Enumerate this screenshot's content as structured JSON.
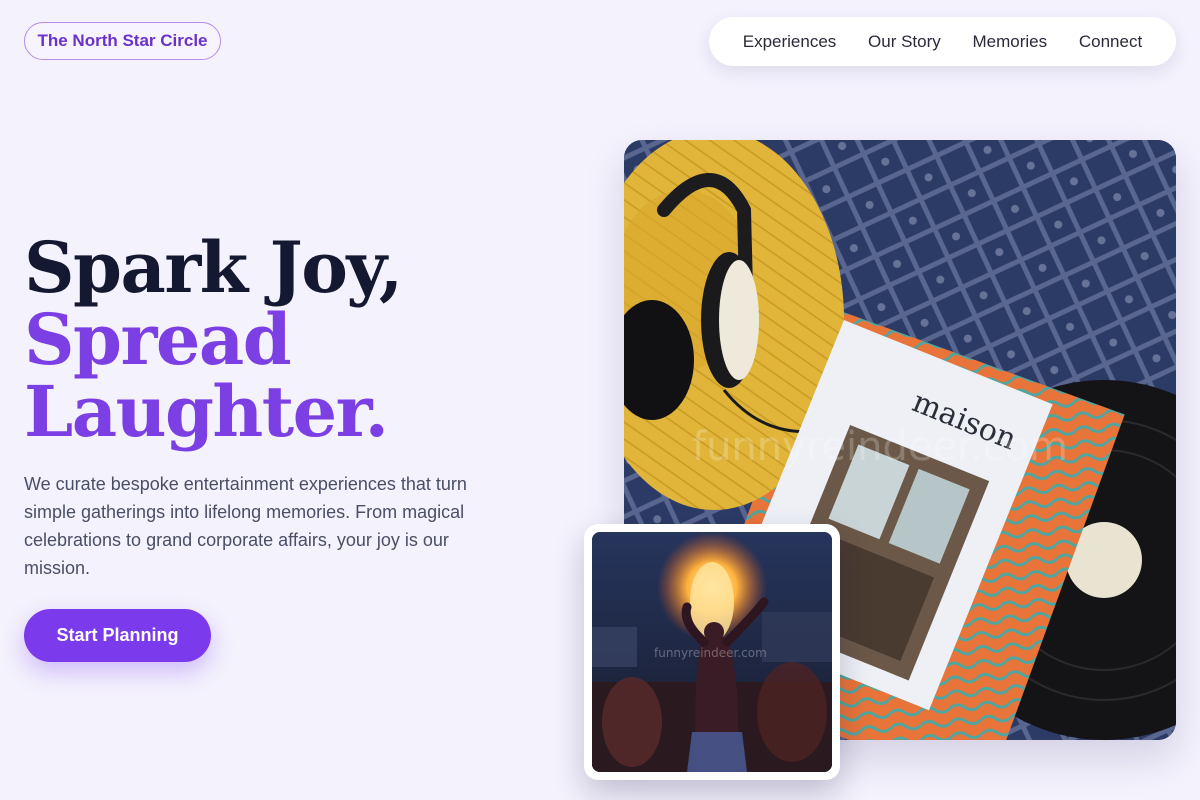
{
  "brand": {
    "label": "The North Star Circle"
  },
  "nav": {
    "items": [
      {
        "label": "Experiences"
      },
      {
        "label": "Our Story"
      },
      {
        "label": "Memories"
      },
      {
        "label": "Connect"
      }
    ]
  },
  "hero": {
    "title_line1": "Spark Joy,",
    "title_line2": "Spread",
    "title_line3": "Laughter.",
    "description": "We curate bespoke entertainment experiences that turn simple gatherings into lifelong memories. From magical celebrations to grand corporate affairs, your joy is our mission.",
    "cta_label": "Start Planning"
  },
  "photos": {
    "main": {
      "magazine_title": "maison",
      "watermark": "funnyreindeer.com"
    },
    "small": {
      "watermark": "funnyreindeer.com"
    }
  },
  "colors": {
    "accent": "#7c3aed",
    "title_dark": "#141830",
    "background": "#f4f2fd"
  }
}
